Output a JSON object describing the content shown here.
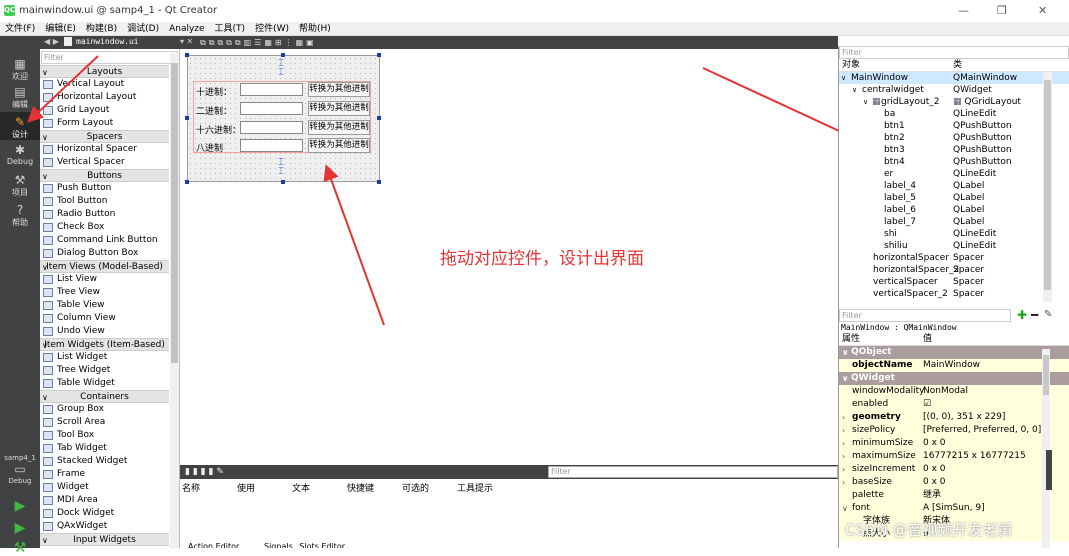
{
  "window": {
    "title": "mainwindow.ui @ samp4_1 - Qt Creator",
    "logo": "QC"
  },
  "menu": [
    "文件(F)",
    "编辑(E)",
    "构建(B)",
    "调试(D)",
    "Analyze",
    "工具(T)",
    "控件(W)",
    "帮助(H)"
  ],
  "modes": [
    {
      "label": "欢迎",
      "icon": "grid-icon"
    },
    {
      "label": "编辑",
      "icon": "doc-icon"
    },
    {
      "label": "设计",
      "icon": "pencil-icon"
    },
    {
      "label": "Debug",
      "icon": "bug-icon"
    },
    {
      "label": "项目",
      "icon": "wrench-icon"
    },
    {
      "label": "帮助",
      "icon": "help-icon"
    }
  ],
  "kit": {
    "project": "samp4_1",
    "mode": "Debug"
  },
  "editor_tab": "mainwindow.ui",
  "widgetbox": {
    "filter_placeholder": "Filter",
    "sections": [
      {
        "title": "Layouts",
        "items": [
          "Vertical Layout",
          "Horizontal Layout",
          "Grid Layout",
          "Form Layout"
        ]
      },
      {
        "title": "Spacers",
        "items": [
          "Horizontal Spacer",
          "Vertical Spacer"
        ]
      },
      {
        "title": "Buttons",
        "items": [
          "Push Button",
          "Tool Button",
          "Radio Button",
          "Check Box",
          "Command Link Button",
          "Dialog Button Box"
        ]
      },
      {
        "title": "Item Views (Model-Based)",
        "items": [
          "List View",
          "Tree View",
          "Table View",
          "Column View",
          "Undo View"
        ]
      },
      {
        "title": "Item Widgets (Item-Based)",
        "items": [
          "List Widget",
          "Tree Widget",
          "Table Widget"
        ]
      },
      {
        "title": "Containers",
        "items": [
          "Group Box",
          "Scroll Area",
          "Tool Box",
          "Tab Widget",
          "Stacked Widget",
          "Frame",
          "Widget",
          "MDI Area",
          "Dock Widget",
          "QAxWidget"
        ]
      },
      {
        "title": "Input Widgets",
        "items": []
      }
    ]
  },
  "form": {
    "rows": [
      {
        "label": "十进制：",
        "button": "转换为其他进制"
      },
      {
        "label": "二进制：",
        "button": "转换为其他进制"
      },
      {
        "label": "十六进制：",
        "button": "转换为其他进制"
      },
      {
        "label": "八进制",
        "button": "转换为其他进制"
      }
    ]
  },
  "annotation": "拖动对应控件，设计出界面",
  "bottom": {
    "filter_placeholder": "Filter",
    "columns": [
      "名称",
      "使用",
      "文本",
      "快捷键",
      "可选的",
      "工具提示"
    ],
    "tabs": [
      "Action Editor",
      "Signals _Slots Editor"
    ]
  },
  "object_inspector": {
    "filter_placeholder": "Filter",
    "headers": [
      "对象",
      "类"
    ],
    "rows": [
      {
        "name": "MainWindow",
        "cls": "QMainWindow",
        "level": 0,
        "sel": true
      },
      {
        "name": "centralwidget",
        "cls": "QWidget",
        "level": 1
      },
      {
        "name": "gridLayout_2",
        "cls": "QGridLayout",
        "level": 2
      },
      {
        "name": "ba",
        "cls": "QLineEdit",
        "level": 3
      },
      {
        "name": "btn1",
        "cls": "QPushButton",
        "level": 3
      },
      {
        "name": "btn2",
        "cls": "QPushButton",
        "level": 3
      },
      {
        "name": "btn3",
        "cls": "QPushButton",
        "level": 3
      },
      {
        "name": "btn4",
        "cls": "QPushButton",
        "level": 3
      },
      {
        "name": "er",
        "cls": "QLineEdit",
        "level": 3
      },
      {
        "name": "label_4",
        "cls": "QLabel",
        "level": 3
      },
      {
        "name": "label_5",
        "cls": "QLabel",
        "level": 3
      },
      {
        "name": "label_6",
        "cls": "QLabel",
        "level": 3
      },
      {
        "name": "label_7",
        "cls": "QLabel",
        "level": 3
      },
      {
        "name": "shi",
        "cls": "QLineEdit",
        "level": 3
      },
      {
        "name": "shiliu",
        "cls": "QLineEdit",
        "level": 3
      },
      {
        "name": "horizontalSpacer",
        "cls": "Spacer",
        "level": 2
      },
      {
        "name": "horizontalSpacer_2",
        "cls": "Spacer",
        "level": 2
      },
      {
        "name": "verticalSpacer",
        "cls": "Spacer",
        "level": 2
      },
      {
        "name": "verticalSpacer_2",
        "cls": "Spacer",
        "level": 2
      }
    ]
  },
  "property_editor": {
    "filter_placeholder": "Filter",
    "context": "MainWindow : QMainWindow",
    "headers": [
      "属性",
      "值"
    ],
    "rows": [
      {
        "type": "sec",
        "k": "QObject"
      },
      {
        "type": "row",
        "k": "objectName",
        "v": "MainWindow",
        "bold": true
      },
      {
        "type": "sec",
        "k": "QWidget"
      },
      {
        "type": "row",
        "k": "windowModality",
        "v": "NonModal"
      },
      {
        "type": "row",
        "k": "enabled",
        "v": "☑"
      },
      {
        "type": "row",
        "k": "geometry",
        "v": "[(0, 0), 351 x 229]",
        "bold": true,
        "ex": true
      },
      {
        "type": "row",
        "k": "sizePolicy",
        "v": "[Preferred, Preferred, 0, 0]",
        "ex": true
      },
      {
        "type": "row",
        "k": "minimumSize",
        "v": "0 x 0",
        "ex": true
      },
      {
        "type": "row",
        "k": "maximumSize",
        "v": "16777215 x 16777215",
        "ex": true
      },
      {
        "type": "row",
        "k": "sizeIncrement",
        "v": "0 x 0",
        "ex": true
      },
      {
        "type": "row",
        "k": "baseSize",
        "v": "0 x 0",
        "ex": true
      },
      {
        "type": "row",
        "k": "palette",
        "v": "继承"
      },
      {
        "type": "row",
        "k": "font",
        "v": "A [SimSun, 9]",
        "ex": true,
        "open": true
      },
      {
        "type": "row",
        "k": "字体族",
        "v": "新宋体",
        "sub": true
      },
      {
        "type": "row",
        "k": "点大小",
        "v": "9",
        "sub": true
      }
    ]
  },
  "watermark": "CSDN @音视频开发老舅",
  "colors": {
    "accent": "#41cd52",
    "annotation": "#e53333",
    "modebar": "#404244",
    "section": "#ab9d9d",
    "propRow": "#ffffdc"
  }
}
